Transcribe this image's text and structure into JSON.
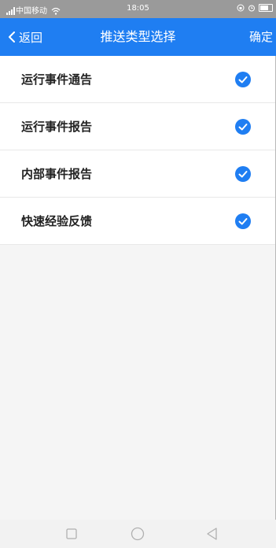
{
  "status_bar": {
    "carrier": "中国移动",
    "time": "18:05",
    "icons": [
      "signal-icon",
      "wifi-icon",
      "lock-icon",
      "alarm-icon",
      "battery-icon"
    ]
  },
  "nav": {
    "back_label": "返回",
    "title": "推送类型选择",
    "confirm_label": "确定",
    "accent_color": "#1f7ef2"
  },
  "options": [
    {
      "label": "运行事件通告",
      "checked": true
    },
    {
      "label": "运行事件报告",
      "checked": true
    },
    {
      "label": "内部事件报告",
      "checked": true
    },
    {
      "label": "快速经验反馈",
      "checked": true
    }
  ],
  "system_nav": {
    "buttons": [
      "recent-apps-icon",
      "home-icon",
      "back-triangle-icon"
    ]
  }
}
